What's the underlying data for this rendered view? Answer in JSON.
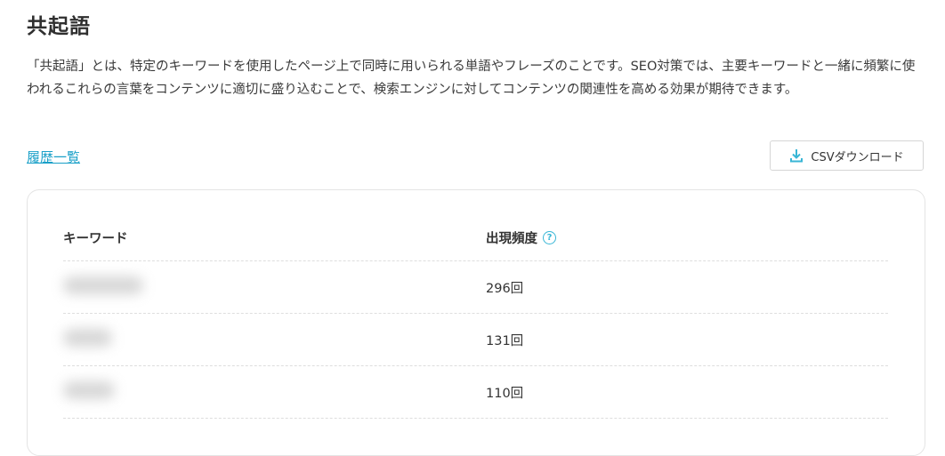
{
  "page": {
    "title": "共起語",
    "description": "「共起語」とは、特定のキーワードを使用したページ上で同時に用いられる単語やフレーズのことです。SEO対策では、主要キーワードと一緒に頻繁に使われるこれらの言葉をコンテンツに適切に盛り込むことで、検索エンジンに対してコンテンツの関連性を高める効果が期待できます。"
  },
  "actions": {
    "history_link": "履歴一覧",
    "csv_download": "CSVダウンロード"
  },
  "table": {
    "columns": [
      "キーワード",
      "出現頻度"
    ],
    "rows": [
      {
        "keyword": "",
        "frequency": "296回"
      },
      {
        "keyword": "",
        "frequency": "131回"
      },
      {
        "keyword": "",
        "frequency": "110回"
      }
    ]
  },
  "colors": {
    "accent": "#1aa0c8",
    "help_icon": "#38b6d6"
  },
  "icons": {
    "download": "download-icon",
    "help": "help-icon"
  }
}
